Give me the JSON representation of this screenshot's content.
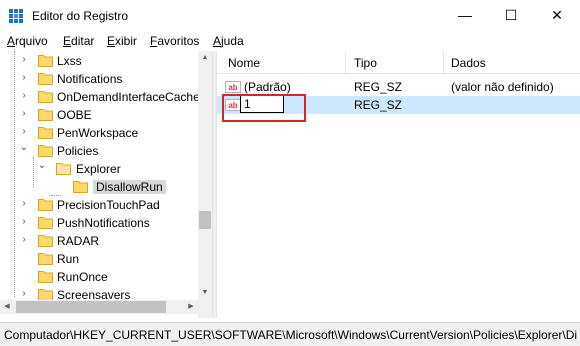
{
  "window": {
    "title": "Editor do Registro",
    "controls": {
      "minimize": "—",
      "maximize": "☐",
      "close": "✕"
    }
  },
  "menu": [
    {
      "label": "Arquivo",
      "accel": "A",
      "rest": "rquivo"
    },
    {
      "label": "Editar",
      "accel": "E",
      "rest": "ditar"
    },
    {
      "label": "Exibir",
      "accel": "E",
      "rest": "xibir"
    },
    {
      "label": "Favoritos",
      "accel": "F",
      "rest": "avoritos"
    },
    {
      "label": "Ajuda",
      "accel": "A",
      "rest": "juda"
    }
  ],
  "tree": {
    "items": [
      {
        "label": "Lxss",
        "chevron": "›"
      },
      {
        "label": "Notifications",
        "chevron": "›"
      },
      {
        "label": "OnDemandInterfaceCache",
        "chevron": "›"
      },
      {
        "label": "OOBE",
        "chevron": "›"
      },
      {
        "label": "PenWorkspace",
        "chevron": "›"
      },
      {
        "label": "Policies",
        "chevron": "⌄"
      },
      {
        "label": "Explorer",
        "chevron": "⌄"
      },
      {
        "label": "DisallowRun",
        "chevron": ""
      },
      {
        "label": "PrecisionTouchPad",
        "chevron": "›"
      },
      {
        "label": "PushNotifications",
        "chevron": "›"
      },
      {
        "label": "RADAR",
        "chevron": "›"
      },
      {
        "label": "Run",
        "chevron": ""
      },
      {
        "label": "RunOnce",
        "chevron": ""
      },
      {
        "label": "Screensavers",
        "chevron": "›"
      }
    ],
    "selected": "DisallowRun"
  },
  "list": {
    "columns": [
      "Nome",
      "Tipo",
      "Dados"
    ],
    "rows": [
      {
        "name": "(Padrão)",
        "type": "REG_SZ",
        "data": "(valor não definido)"
      },
      {
        "name": "",
        "type": "REG_SZ",
        "data": ""
      }
    ],
    "rename_value": "1"
  },
  "statusbar": {
    "path": "Computador\\HKEY_CURRENT_USER\\SOFTWARE\\Microsoft\\Windows\\CurrentVersion\\Policies\\Explorer\\Di"
  },
  "colors": {
    "selection": "#cce8ff",
    "highlight_border": "#d62728",
    "folder_fill": "#ffd86a",
    "ab_icon": "#c8413b"
  },
  "icons": {
    "app": "registry-editor-icon",
    "folder": "folder-icon",
    "value": "string-value-icon"
  }
}
